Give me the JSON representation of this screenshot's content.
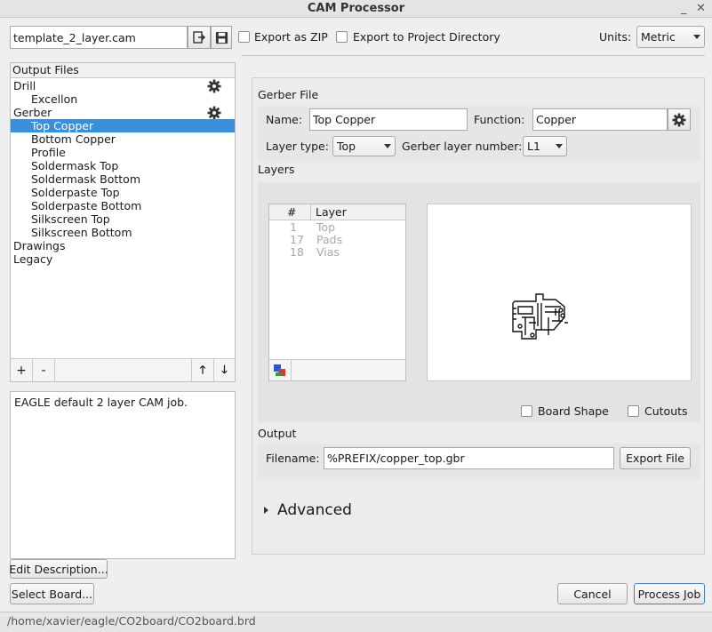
{
  "window": {
    "title": "CAM Processor"
  },
  "toolbar": {
    "cam_file": "template_2_layer.cam",
    "export_zip_label": "Export as ZIP",
    "export_project_label": "Export to Project Directory",
    "units_label": "Units:",
    "units_value": "Metric"
  },
  "output_files": {
    "header": "Output Files",
    "items": [
      {
        "label": "Drill"
      },
      {
        "label": "Excellon"
      },
      {
        "label": "Gerber"
      },
      {
        "label": "Top Copper"
      },
      {
        "label": "Bottom Copper"
      },
      {
        "label": "Profile"
      },
      {
        "label": "Soldermask Top"
      },
      {
        "label": "Soldermask Bottom"
      },
      {
        "label": "Solderpaste Top"
      },
      {
        "label": "Solderpaste Bottom"
      },
      {
        "label": "Silkscreen Top"
      },
      {
        "label": "Silkscreen Bottom"
      },
      {
        "label": "Drawings"
      },
      {
        "label": "Legacy"
      }
    ],
    "add_label": "+",
    "remove_label": "-"
  },
  "description": {
    "text": "EAGLE default 2 layer CAM job."
  },
  "buttons": {
    "edit_description": "Edit Description...",
    "select_board": "Select Board...",
    "cancel": "Cancel",
    "process_job": "Process Job",
    "export_file": "Export File"
  },
  "gerber": {
    "section_title": "Gerber File",
    "name_label": "Name:",
    "name_value": "Top Copper",
    "function_label": "Function:",
    "function_value": "Copper",
    "layer_type_label": "Layer type:",
    "layer_type_value": "Top",
    "layer_number_label": "Gerber layer number:",
    "layer_number_value": "L1"
  },
  "layers": {
    "section_title": "Layers",
    "col_num": "#",
    "col_layer": "Layer",
    "rows": [
      {
        "num": "1",
        "name": "Top"
      },
      {
        "num": "17",
        "name": "Pads"
      },
      {
        "num": "18",
        "name": "Vias"
      }
    ],
    "board_shape_label": "Board Shape",
    "cutouts_label": "Cutouts"
  },
  "output": {
    "section_title": "Output",
    "filename_label": "Filename:",
    "filename_value": "%PREFIX/copper_top.gbr"
  },
  "advanced": {
    "label": "Advanced"
  },
  "status_bar": {
    "path": "/home/xavier/eagle/CO2board/CO2board.brd"
  }
}
